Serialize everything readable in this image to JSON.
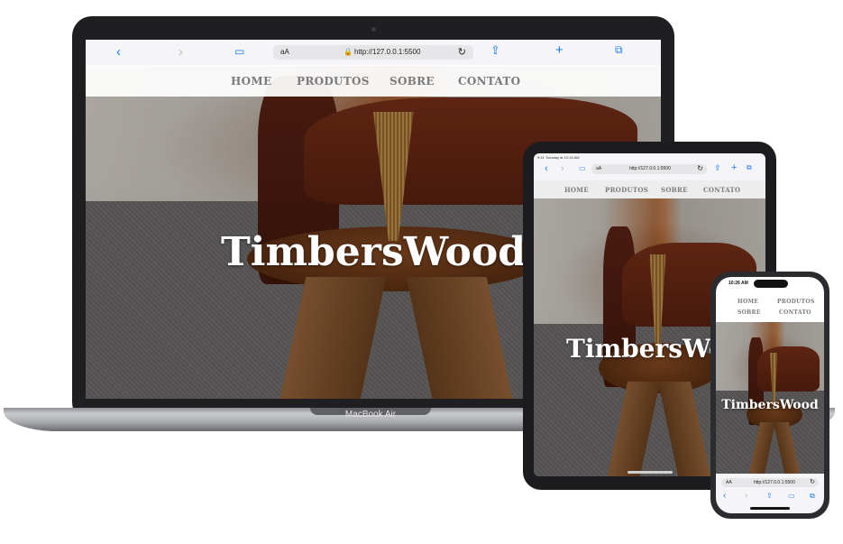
{
  "laptop": {
    "url": "http://127.0.0.1:5500",
    "text_size": "aA",
    "nav": [
      "HOME",
      "PRODUTOS",
      "SOBRE",
      "CONTATO"
    ],
    "brand": "TimbersWood",
    "model_label": "MacBook Air"
  },
  "tablet": {
    "status_time": "9:41 Tuesday at 10:15 AM",
    "url": "http://127.0.0.1:5500",
    "text_size": "aA",
    "nav": [
      "HOME",
      "PRODUTOS",
      "SOBRE",
      "CONTATO"
    ],
    "brand": "TimbersWoo"
  },
  "phone": {
    "status_time": "10:26 AM",
    "nav": [
      "HOME",
      "PRODUTOS",
      "SOBRE",
      "CONTATO"
    ],
    "brand": "TimbersWood",
    "text_size": "AA",
    "url": "http://127.0.0.1:5500"
  },
  "colors": {
    "accent": "#1a7cf5",
    "nav_text": "#7b7b7b",
    "brand_text": "#ffffff"
  }
}
